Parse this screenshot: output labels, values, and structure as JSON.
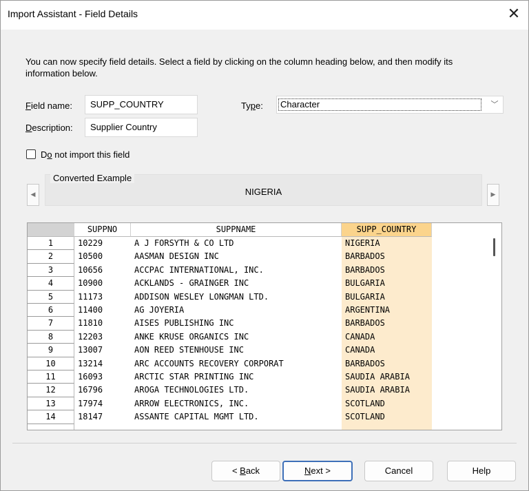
{
  "window": {
    "title": "Import Assistant - Field Details",
    "close_glyph": "✕"
  },
  "intro_text": "You can now specify field details. Select a field by clicking on the column heading below, and then modify its information below.",
  "field_name": {
    "label_accel": "F",
    "label_rest": "ield name:",
    "value": "SUPP_COUNTRY"
  },
  "description": {
    "label_accel": "D",
    "label_rest": "escription:",
    "value": "Supplier Country"
  },
  "type": {
    "label_pre": "Ty",
    "label_accel": "p",
    "label_post": "e:",
    "value": "Character",
    "arrow": "﹀"
  },
  "do_not_import": {
    "label_pre": "D",
    "label_accel": "o",
    "label_post": " not import this field",
    "checked": false
  },
  "converted_example": {
    "legend": "Converted Example",
    "value": "NIGERIA",
    "prev_glyph": "◀",
    "next_glyph": "▶"
  },
  "grid": {
    "columns": [
      "SUPPNO",
      "SUPPNAME",
      "SUPP_COUNTRY"
    ],
    "selected_column": "SUPP_COUNTRY",
    "rows": [
      {
        "n": "1",
        "suppno": "10229",
        "suppname": "A J FORSYTH & CO LTD",
        "country": "NIGERIA"
      },
      {
        "n": "2",
        "suppno": "10500",
        "suppname": "AASMAN DESIGN INC",
        "country": "BARBADOS"
      },
      {
        "n": "3",
        "suppno": "10656",
        "suppname": "ACCPAC INTERNATIONAL, INC.",
        "country": "BARBADOS"
      },
      {
        "n": "4",
        "suppno": "10900",
        "suppname": "ACKLANDS - GRAINGER INC",
        "country": "BULGARIA"
      },
      {
        "n": "5",
        "suppno": "11173",
        "suppname": "ADDISON WESLEY LONGMAN LTD.",
        "country": "BULGARIA"
      },
      {
        "n": "6",
        "suppno": "11400",
        "suppname": "AG JOYERIA",
        "country": "ARGENTINA"
      },
      {
        "n": "7",
        "suppno": "11810",
        "suppname": "AISES PUBLISHING INC",
        "country": "BARBADOS"
      },
      {
        "n": "8",
        "suppno": "12203",
        "suppname": "ANKE KRUSE ORGANICS INC",
        "country": "CANADA"
      },
      {
        "n": "9",
        "suppno": "13007",
        "suppname": "AON REED STENHOUSE INC",
        "country": "CANADA"
      },
      {
        "n": "10",
        "suppno": "13214",
        "suppname": "ARC ACCOUNTS RECOVERY CORPORAT",
        "country": "BARBADOS"
      },
      {
        "n": "11",
        "suppno": "16093",
        "suppname": "ARCTIC STAR PRINTING INC",
        "country": "SAUDIA ARABIA"
      },
      {
        "n": "12",
        "suppno": "16796",
        "suppname": "AROGA TECHNOLOGIES LTD.",
        "country": "SAUDIA ARABIA"
      },
      {
        "n": "13",
        "suppno": "17974",
        "suppname": "ARROW ELECTRONICS, INC.",
        "country": "SCOTLAND"
      },
      {
        "n": "14",
        "suppno": "18147",
        "suppname": "ASSANTE CAPITAL MGMT LTD.",
        "country": "SCOTLAND"
      }
    ]
  },
  "buttons": {
    "back": {
      "pre": "< ",
      "accel": "B",
      "post": "ack"
    },
    "next": {
      "pre": "",
      "accel": "N",
      "post": "ext >"
    },
    "cancel": "Cancel",
    "help": "Help"
  },
  "colors": {
    "selected_header": "#fbd48c",
    "selected_column": "#fdebcd",
    "default_button_border": "#3d6fb8"
  }
}
